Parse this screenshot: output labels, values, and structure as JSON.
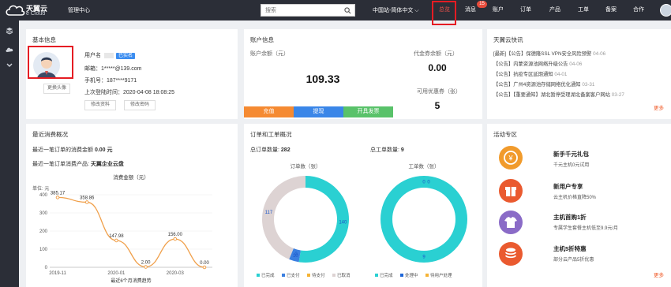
{
  "brand": {
    "name": "天翼云",
    "sub": "e Cloud"
  },
  "header": {
    "mgmt": "管理中心",
    "search_placeholder": "搜索",
    "region": "中国站-简体中文",
    "nav": [
      "总览",
      "消息",
      "账户",
      "订单",
      "产品",
      "工单",
      "备案",
      "合作"
    ],
    "msg_count": "15"
  },
  "basic": {
    "title": "基本信息",
    "user_label": "用户名",
    "user_value": "",
    "verified": "已实名",
    "email": "邮箱：1*****@139.com",
    "phone": "手机号：187****9171",
    "last_login": "上次登陆时间：2020-04-08 18:08:25",
    "change_avatar": "更换头像",
    "edit_profile": "修改资料",
    "change_pwd": "修改密码"
  },
  "account": {
    "title": "账户信息",
    "balance_label": "账户余额（元）",
    "balance": "109.33",
    "voucher_label": "代金券余额（元）",
    "voucher": "0.00",
    "coupon_label": "可用优惠券（张）",
    "coupon": "5",
    "btn_recharge": "充值",
    "btn_withdraw": "提现",
    "btn_invoice": "开具发票"
  },
  "news": {
    "title": "天翼云快讯",
    "items": [
      {
        "text": "[最新]【公告】保德隆SSL VPN安全风险预警",
        "date": "04-06"
      },
      {
        "text": "【公告】内蒙资源池网络升级公告",
        "date": "04-06"
      },
      {
        "text": "【公告】抗疫专区延期通知",
        "date": "04-01"
      },
      {
        "text": "【公告】广州4资源池存储网络优化通知",
        "date": "03-31"
      },
      {
        "text": "【公告】【重要通知】湖北暂停受理湖北备案客户网站",
        "date": "03-27"
      }
    ],
    "more": "更多"
  },
  "consumption": {
    "title": "最近消费概况",
    "last_amount_label": "最近一笔订单的消费金额",
    "last_amount": "0.00 元",
    "last_product_label": "最近一笔订单消费产品:",
    "last_product": "天翼企业云盘"
  },
  "chart_data": [
    {
      "type": "line",
      "title": "消费金额（元）",
      "ylabel": "单位: 元",
      "xlabel": "最近6个月消费趋势",
      "x": [
        "2019-11",
        "2019-12",
        "2020-01",
        "2020-02",
        "2020-03",
        "2020-04"
      ],
      "x_tick_labels": [
        "2019-11",
        "2020-01",
        "2020-03"
      ],
      "values": [
        385.17,
        358.86,
        147.98,
        2.0,
        156.0,
        0.0
      ],
      "value_labels": [
        "385.17",
        "358.86",
        "147.98",
        "2.00",
        "156.00",
        "0.00"
      ],
      "ylim": [
        0,
        400
      ],
      "yticks": [
        "400",
        "300",
        "200",
        "100",
        "0"
      ],
      "color": "#f0a04b"
    },
    {
      "type": "pie",
      "title": "订单数（张）",
      "categories": [
        "已完成",
        "已支付",
        "待支付",
        "已取消"
      ],
      "values": [
        140,
        10,
        0,
        117
      ],
      "value_labels": [
        "140",
        "10",
        "0",
        "117"
      ],
      "colors": [
        "#2ad0d2",
        "#3a7fe0",
        "#f5b335",
        "#ddd3d3"
      ]
    },
    {
      "type": "pie",
      "title": "工单数（张）",
      "categories": [
        "已完成",
        "处理中",
        "待用户处理"
      ],
      "values": [
        9,
        0,
        0
      ],
      "value_labels": [
        "9",
        "0",
        "0"
      ],
      "colors": [
        "#2ad0d2",
        "#1f67d9",
        "#f5b335"
      ]
    }
  ],
  "orders": {
    "title": "订单和工单概况",
    "total_orders_label": "总订单数量:",
    "total_orders": "282",
    "total_tickets_label": "总工单数量:",
    "total_tickets": "9"
  },
  "activity": {
    "title": "活动专区",
    "items": [
      {
        "title": "新手千元礼包",
        "desc": "千元主机0元试用",
        "icon": "coin-icon",
        "color": "#f19b2c"
      },
      {
        "title": "新用户专享",
        "desc": "云主机价格直降50%",
        "icon": "gift-icon",
        "color": "#ea5a2f"
      },
      {
        "title": "主机首购1折",
        "desc": "专属学生套餐主机低至9.9元/月",
        "icon": "shirt-icon",
        "color": "#8a6bc7"
      },
      {
        "title": "主机5折特惠",
        "desc": "部分云产品5折优惠",
        "icon": "coins-stack-icon",
        "color": "#ea5a2f"
      }
    ],
    "more": "更多"
  }
}
